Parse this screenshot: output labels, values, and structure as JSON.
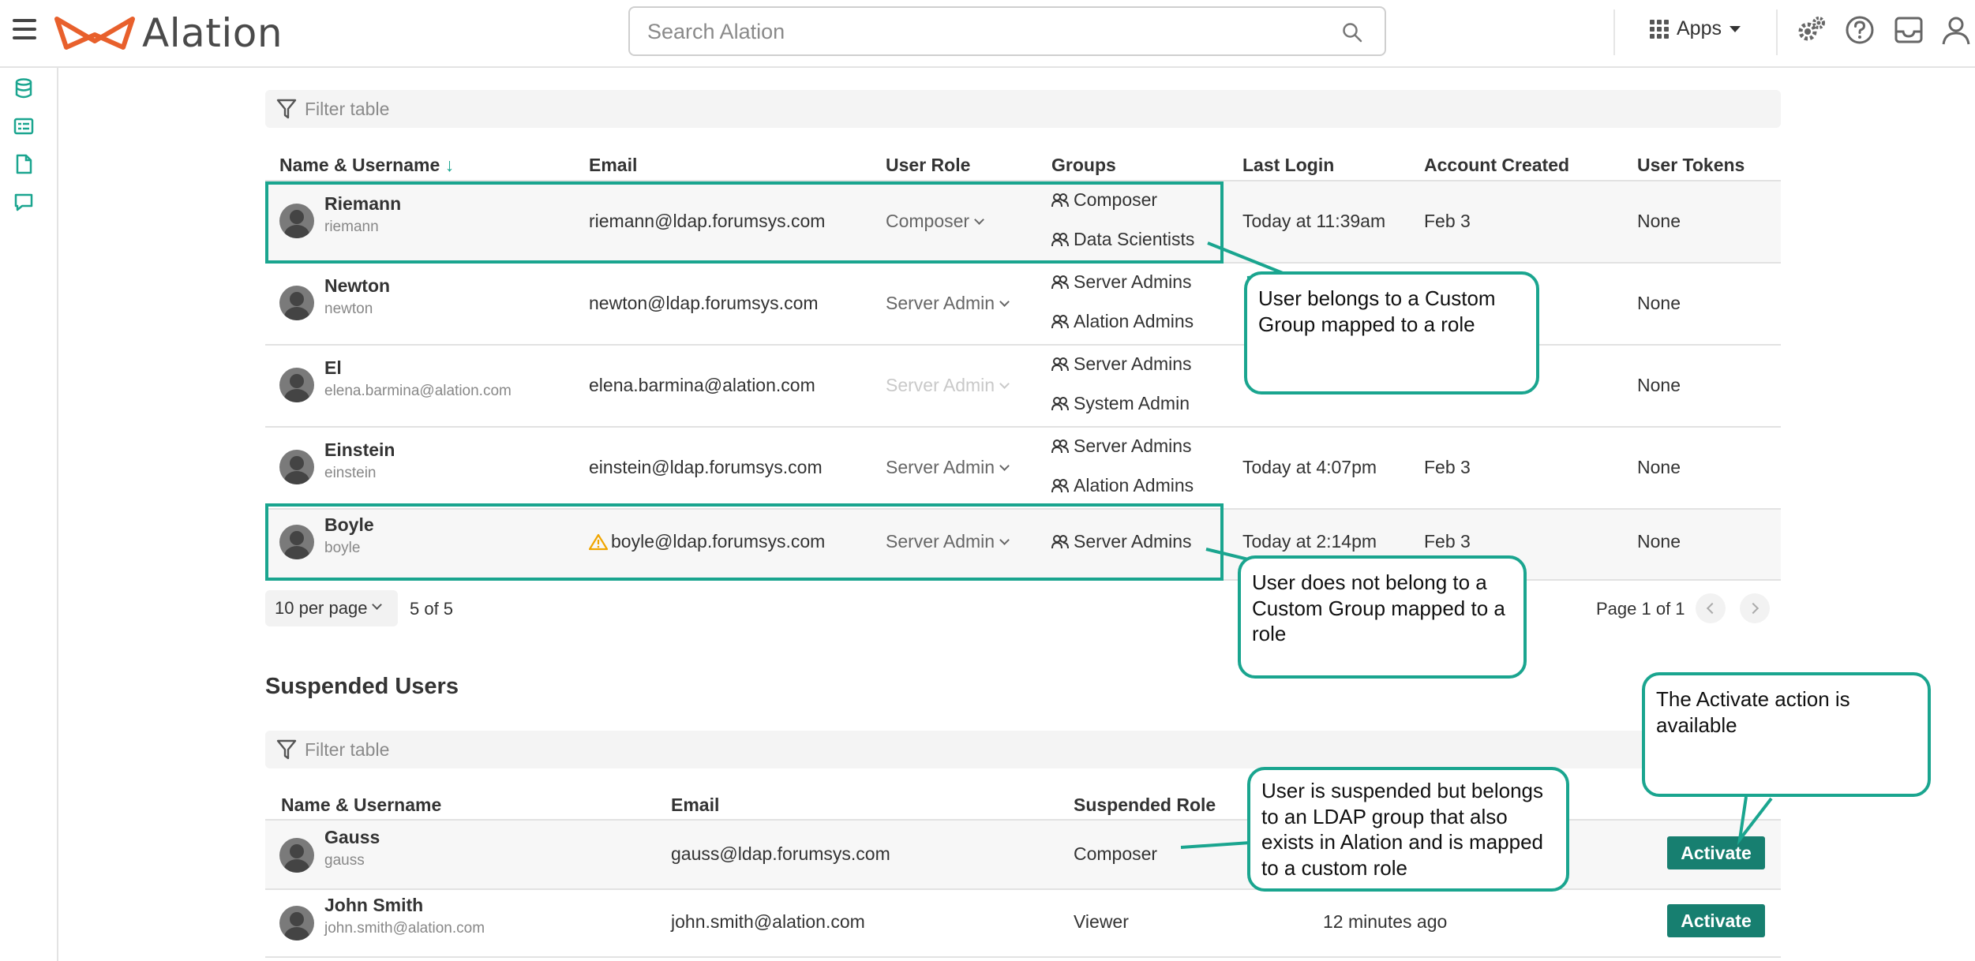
{
  "topbar": {
    "logo_text": "Alation",
    "search_placeholder": "Search Alation",
    "apps_label": "Apps",
    "icons": [
      "menu-icon",
      "search-icon",
      "apps-grid-icon",
      "settings-icon",
      "help-icon",
      "inbox-icon",
      "user-icon"
    ]
  },
  "rail": {
    "icons": [
      "database-icon",
      "catalog-icon",
      "document-icon",
      "conversation-icon"
    ]
  },
  "colors": {
    "accent": "#1aa58f",
    "button": "#177f70",
    "warning": "#f0a500",
    "logo": "#e8602c"
  },
  "users_table": {
    "filter_placeholder": "Filter table",
    "headers": {
      "name": "Name & Username",
      "email": "Email",
      "role": "User Role",
      "groups": "Groups",
      "last_login": "Last Login",
      "created": "Account Created",
      "tokens": "User Tokens"
    },
    "sort_indicator": "↓",
    "rows": [
      {
        "name": "Riemann",
        "username": "riemann",
        "email": "riemann@ldap.forumsys.com",
        "role": "Composer",
        "groups": [
          "Composer",
          "Data Scientists"
        ],
        "last_login": "Today at 11:39am",
        "created": "Feb 3",
        "tokens": "None"
      },
      {
        "name": "Newton",
        "username": "newton",
        "email": "newton@ldap.forumsys.com",
        "role": "Server Admin",
        "groups": [
          "Server Admins",
          "Alation Admins"
        ],
        "last_login": "",
        "created": "",
        "tokens": "None"
      },
      {
        "name": "El",
        "username": "elena.barmina@alation.com",
        "email": "elena.barmina@alation.com",
        "role": "Server Admin",
        "groups": [
          "Server Admins",
          "System Admin"
        ],
        "last_login": "",
        "created": "",
        "tokens": "None"
      },
      {
        "name": "Einstein",
        "username": "einstein",
        "email": "einstein@ldap.forumsys.com",
        "role": "Server Admin",
        "groups": [
          "Server Admins",
          "Alation Admins"
        ],
        "last_login": "Today at 4:07pm",
        "created": "Feb 3",
        "tokens": "None"
      },
      {
        "name": "Boyle",
        "username": "boyle",
        "email": "boyle@ldap.forumsys.com",
        "role": "Server Admin",
        "groups": [
          "Server Admins"
        ],
        "last_login": "Today at 2:14pm",
        "created": "Feb 3",
        "tokens": "None"
      }
    ],
    "per_page": "10 per page",
    "count": "5 of 5",
    "page": "Page 1 of 1"
  },
  "suspended": {
    "title": "Suspended Users",
    "filter_placeholder": "Filter table",
    "headers": {
      "name": "Name & Username",
      "email": "Email",
      "role": "Suspended Role"
    },
    "rows": [
      {
        "name": "Gauss",
        "username": "gauss",
        "email": "gauss@ldap.forumsys.com",
        "role": "Composer",
        "time": "",
        "action": "Activate"
      },
      {
        "name": "John Smith",
        "username": "john.smith@alation.com",
        "email": "john.smith@alation.com",
        "role": "Viewer",
        "time": "12 minutes ago",
        "action": "Activate"
      }
    ]
  },
  "callouts": {
    "custom_group": "User belongs to a Custom Group mapped to a role",
    "no_custom_group": "User does not belong to a Custom Group mapped to a role",
    "activate": "The Activate action is available",
    "suspended_ldap": "User is suspended but belongs to an LDAP group that also exists in Alation and is mapped to a custom role"
  }
}
